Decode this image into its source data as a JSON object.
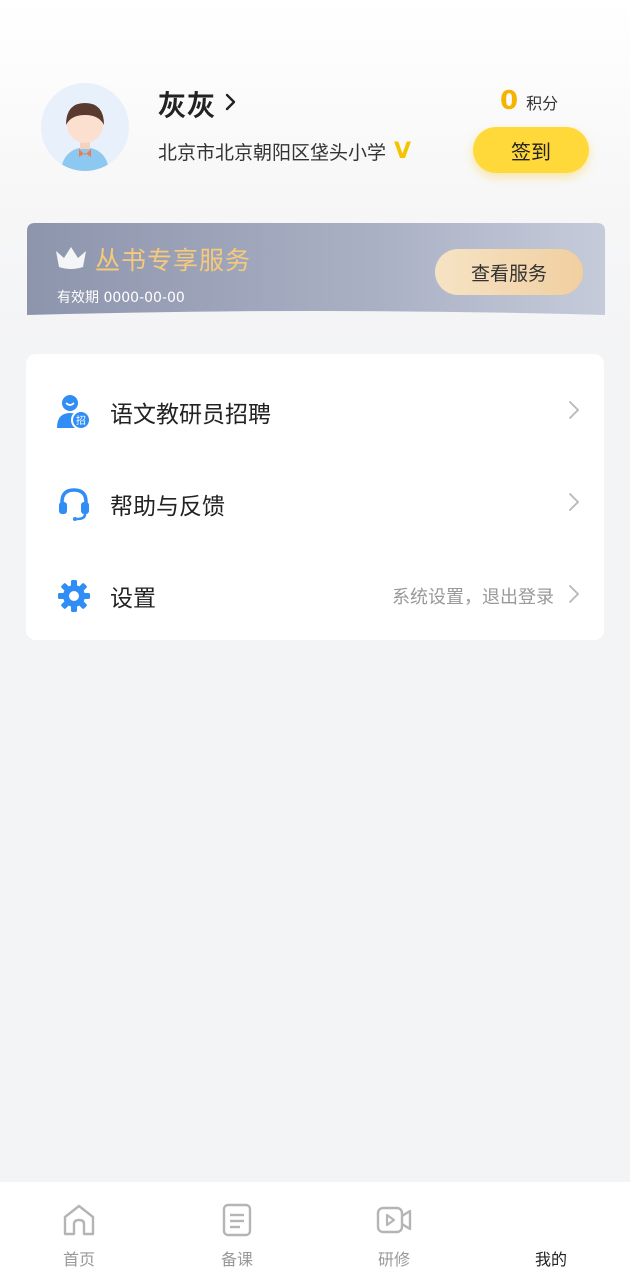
{
  "profile": {
    "username": "灰灰",
    "school": "北京市北京朝阳区垡头小学",
    "verified_badge": "V",
    "points_value": "0",
    "points_label": "积分",
    "checkin_label": "签到"
  },
  "vip": {
    "title": "丛书专享服务",
    "expiry": "有效期 0000-00-00",
    "button_label": "查看服务",
    "icon": "crown-icon"
  },
  "menu": {
    "items": [
      {
        "label": "语文教研员招聘",
        "icon": "recruit-person-icon",
        "desc": ""
      },
      {
        "label": "帮助与反馈",
        "icon": "headset-icon",
        "desc": ""
      },
      {
        "label": "设置",
        "icon": "gear-icon",
        "desc": "系统设置，退出登录"
      }
    ]
  },
  "tabbar": {
    "tabs": [
      {
        "label": "首页",
        "icon": "home-icon",
        "active": false
      },
      {
        "label": "备课",
        "icon": "document-icon",
        "active": false
      },
      {
        "label": "研修",
        "icon": "video-icon",
        "active": false
      },
      {
        "label": "我的",
        "icon": "",
        "active": true
      }
    ]
  },
  "colors": {
    "accent_yellow": "#ffd93a",
    "points_orange": "#f5b400",
    "icon_blue": "#2f8df5",
    "vip_gold": "#f7c97a",
    "background": "#f3f4f6"
  }
}
